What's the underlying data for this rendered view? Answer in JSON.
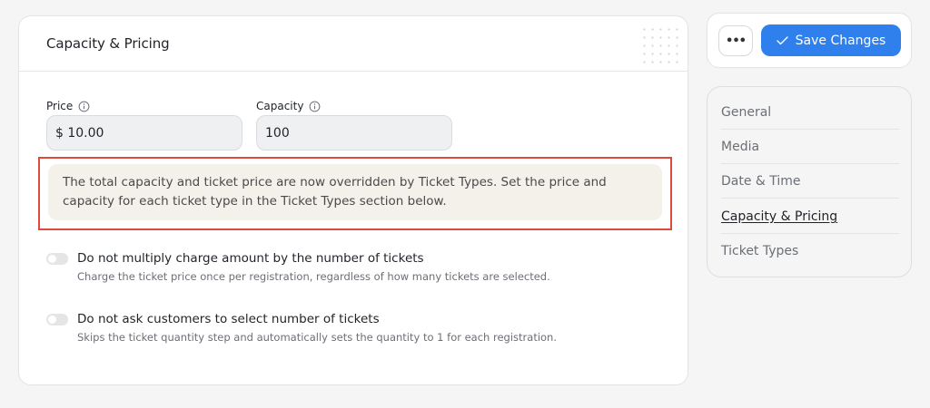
{
  "section": {
    "title": "Capacity & Pricing"
  },
  "price": {
    "label": "Price",
    "value": "$ 10.00"
  },
  "capacity": {
    "label": "Capacity",
    "value": "100"
  },
  "notice": {
    "text": "The total capacity and ticket price are now overridden by Ticket Types. Set the price and capacity for each ticket type in the Ticket Types section below."
  },
  "options": [
    {
      "title": "Do not multiply charge amount by the number of tickets",
      "description": "Charge the ticket price once per registration, regardless of how many tickets are selected.",
      "enabled": false
    },
    {
      "title": "Do not ask customers to select number of tickets",
      "description": "Skips the ticket quantity step and automatically sets the quantity to 1 for each registration.",
      "enabled": false
    }
  ],
  "actions": {
    "more_label": "•••",
    "save_label": "Save Changes",
    "accent_color": "#2f80ed"
  },
  "nav": {
    "items": [
      {
        "label": "General",
        "active": false
      },
      {
        "label": "Media",
        "active": false
      },
      {
        "label": "Date & Time",
        "active": false
      },
      {
        "label": "Capacity & Pricing",
        "active": true
      },
      {
        "label": "Ticket Types",
        "active": false
      }
    ]
  }
}
